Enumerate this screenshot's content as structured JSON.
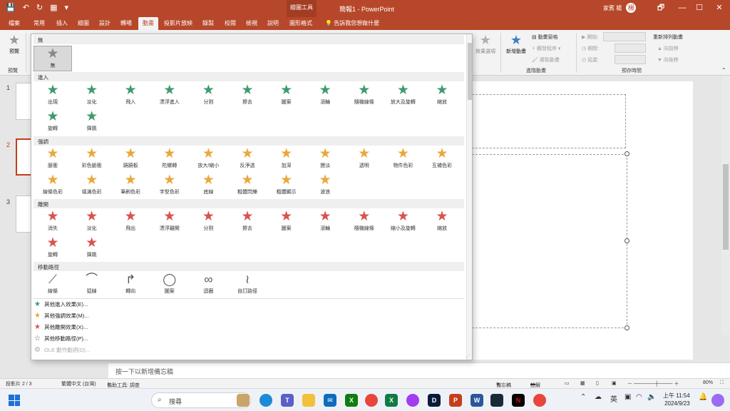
{
  "titlebar": {
    "contextual": "繪圖工具",
    "doc_title": "簡報1 - PowerPoint",
    "user_name": "家賓 楊",
    "user_initial": "楊",
    "qat": [
      "💾",
      "↶",
      "↻",
      "▦",
      "▾"
    ],
    "controls": [
      "🗗",
      "—",
      "☐",
      "✕"
    ]
  },
  "tabs": [
    "檔案",
    "常用",
    "插入",
    "繪圖",
    "設計",
    "轉場",
    "動畫",
    "投影片放映",
    "錄製",
    "校閱",
    "檢視",
    "說明",
    "圖形格式"
  ],
  "tell_me": "告訴我您想做什麼",
  "ribbon": {
    "preview": "預覽",
    "preview_group": "預覽",
    "effect_options": "效果選項",
    "add_animation": "新增動畫",
    "animation_pane": "動畫窗格",
    "trigger": "觸發程序",
    "painter": "複製動畫",
    "advanced_group": "進階動畫",
    "start": "開始:",
    "duration": "期間:",
    "delay": "延遲:",
    "timing_group": "預存時間",
    "reorder": "重新排列動畫",
    "move_earlier": "向前移",
    "move_later": "向後移"
  },
  "slides": [
    "1",
    "2",
    "3"
  ],
  "notes": "按一下以新增備忘稿",
  "gallery": {
    "none_header": "無",
    "none_label": "無",
    "sections": {
      "entrance": "進入",
      "emphasis": "強調",
      "exit": "離開",
      "path": "移動路徑"
    },
    "entrance": [
      "出現",
      "淡化",
      "飛入",
      "漂浮進入",
      "分割",
      "擦去",
      "圖案",
      "滾輪",
      "隨機線條",
      "放大及旋轉",
      "縮放",
      "旋轉",
      "彈跳"
    ],
    "emphasis": [
      "脈衝",
      "彩色脈衝",
      "蹺蹺板",
      "陀螺轉",
      "放大/縮小",
      "反淨透",
      "加深",
      "變淡",
      "透明",
      "物件色彩",
      "互補色彩",
      "線條色彩",
      "填滿色彩",
      "筆刷色彩",
      "字型色彩",
      "底線",
      "粗體閃爍",
      "粗體顯示",
      "波浪"
    ],
    "exit": [
      "消失",
      "淡化",
      "飛出",
      "漂浮離開",
      "分割",
      "擦去",
      "圖案",
      "滾輪",
      "隨機線條",
      "縮小及旋轉",
      "縮放",
      "旋轉",
      "彈跳"
    ],
    "path": [
      "線條",
      "弧線",
      "轉向",
      "圖案",
      "迴圈",
      "自訂路徑"
    ],
    "more": [
      "其他進入效果(E)...",
      "其他強調效果(M)...",
      "其他離開效果(X)...",
      "其他移動路徑(P)...",
      "OLE 動作動詞(O)..."
    ]
  },
  "statusbar": {
    "slide": "投影片 2 / 3",
    "language": "繁體中文 (台灣)",
    "accessibility": "協助工具: 調查",
    "notes": "備忘稿",
    "comments": "註解",
    "zoom": "80%"
  },
  "taskbar": {
    "search": "搜尋",
    "ime": "英",
    "time": "上午 11:54",
    "date": "2024/9/23"
  },
  "colors": {
    "accent": "#b7472a",
    "entrance": "#3e9b6e",
    "emphasis": "#e8a93a",
    "exit": "#d9534f"
  }
}
